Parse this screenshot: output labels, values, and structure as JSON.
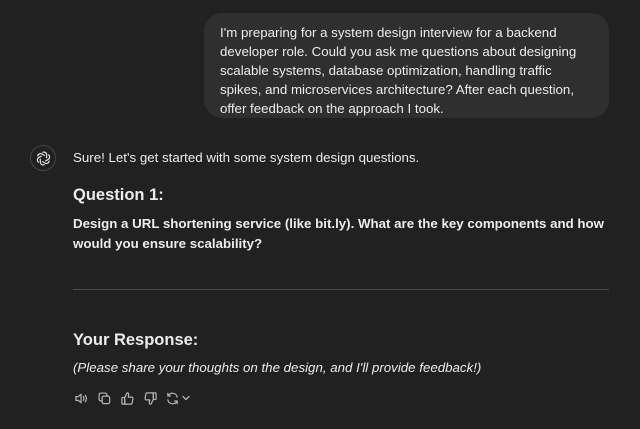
{
  "user_message": {
    "text": "I'm preparing for a system design interview for a backend developer role. Could you ask me questions about designing scalable systems, database optimization, handling traffic spikes, and microservices architecture? After each question, offer feedback on the approach I took."
  },
  "assistant": {
    "avatar_icon": "openai-logo-icon",
    "intro": "Sure! Let's get started with some system design questions.",
    "question_heading": "Question 1:",
    "question_text": "Design a URL shortening service (like bit.ly). What are the key components and how would you ensure scalability?",
    "response_heading": "Your Response:",
    "response_text": "(Please share your thoughts on the design, and I'll provide feedback!)"
  },
  "actions": [
    {
      "name": "read-aloud-icon"
    },
    {
      "name": "copy-icon"
    },
    {
      "name": "thumbs-up-icon"
    },
    {
      "name": "thumbs-down-icon"
    },
    {
      "name": "regenerate-icon"
    },
    {
      "name": "chevron-down-icon"
    }
  ],
  "colors": {
    "background": "#212121",
    "bubble": "#2f2f2f",
    "text": "#ececec",
    "icon": "#b4b4b4",
    "divider": "#4a4a4a"
  }
}
